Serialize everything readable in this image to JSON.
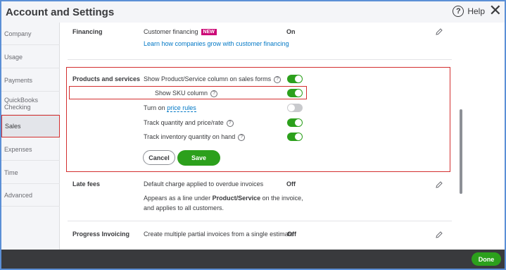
{
  "window": {
    "title": "Account and Settings",
    "help_label": "Help"
  },
  "sidebar": {
    "items": [
      {
        "label": "Company"
      },
      {
        "label": "Usage"
      },
      {
        "label": "Payments"
      },
      {
        "label": "QuickBooks Checking"
      },
      {
        "label": "Sales"
      },
      {
        "label": "Expenses"
      },
      {
        "label": "Time"
      },
      {
        "label": "Advanced"
      }
    ],
    "active": "Sales"
  },
  "financing": {
    "section": "Financing",
    "setting": "Customer financing",
    "badge": "NEW",
    "link": "Learn how companies grow with customer financing",
    "value": "On"
  },
  "products": {
    "section": "Products and services",
    "rows": [
      {
        "label": "Show Product/Service column on sales forms",
        "state": "on"
      },
      {
        "label": "Show SKU column",
        "state": "on"
      },
      {
        "label_prefix": "Turn on ",
        "label_link": "price rules",
        "state": "off"
      },
      {
        "label": "Track quantity and price/rate",
        "state": "on"
      },
      {
        "label": "Track inventory quantity on hand",
        "state": "on"
      }
    ],
    "cancel_label": "Cancel",
    "save_label": "Save"
  },
  "late_fees": {
    "section": "Late fees",
    "setting": "Default charge applied to overdue invoices",
    "value": "Off",
    "desc_prefix": "Appears as a line under ",
    "desc_bold": "Product/Service",
    "desc_suffix": " on the invoice,",
    "desc_line2": "and applies to all customers."
  },
  "progress": {
    "section": "Progress Invoicing",
    "setting": "Create multiple partial invoices from a single estimate",
    "value": "Off"
  },
  "footer": {
    "done_label": "Done"
  },
  "colors": {
    "accent": "#2ca01c",
    "highlight": "#d32f2f",
    "link": "#0077c5",
    "badge": "#cc0a77"
  }
}
